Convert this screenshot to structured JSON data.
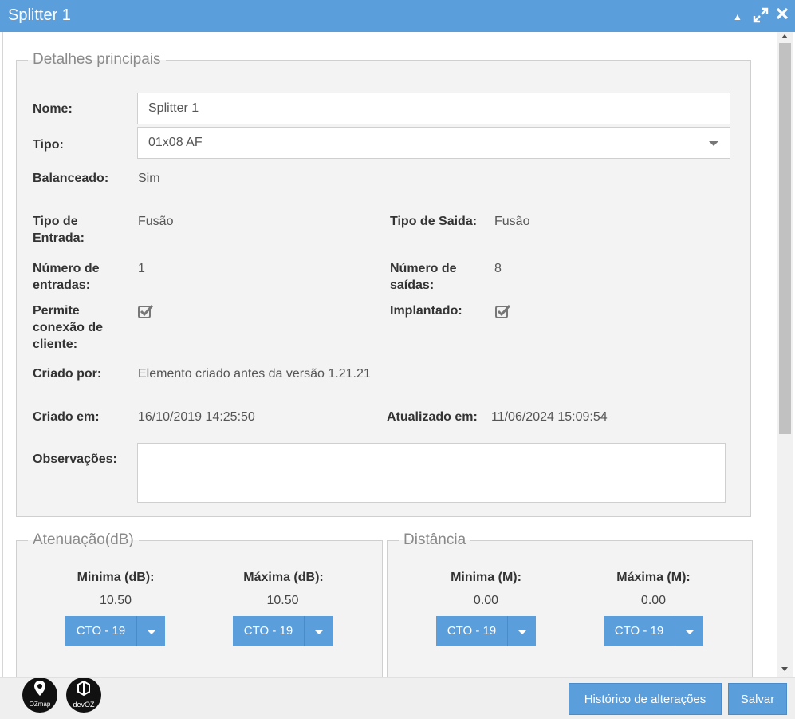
{
  "window": {
    "title": "Splitter 1",
    "controls": {
      "collapse": "▲",
      "expand": "⤢",
      "close": "✖"
    }
  },
  "main_section": {
    "legend": "Detalhes principais",
    "nome": {
      "label": "Nome:",
      "value": "Splitter 1"
    },
    "tipo": {
      "label": "Tipo:",
      "value": "01x08 AF"
    },
    "balanceado": {
      "label": "Balanceado:",
      "value": "Sim"
    },
    "tipo_entrada": {
      "label": "Tipo de Entrada:",
      "value": "Fusão"
    },
    "tipo_saida": {
      "label": "Tipo de Saida:",
      "value": "Fusão"
    },
    "numero_entradas": {
      "label": "Número de entradas:",
      "value": "1"
    },
    "numero_saidas": {
      "label": "Número de saídas:",
      "value": "8"
    },
    "permite_conexao": {
      "label": "Permite conexão de cliente:",
      "checked": true
    },
    "implantado": {
      "label": "Implantado:",
      "checked": true
    },
    "criado_por": {
      "label": "Criado por:",
      "value": "Elemento criado antes da versão 1.21.21"
    },
    "criado_em": {
      "label": "Criado em:",
      "value": "16/10/2019 14:25:50"
    },
    "atualizado_em": {
      "label": "Atualizado em:",
      "value": "11/06/2024 15:09:54"
    },
    "observacoes": {
      "label": "Observações:",
      "value": ""
    }
  },
  "atenuacao": {
    "legend": "Atenuação(dB)",
    "minima": {
      "label": "Minima (dB):",
      "value": "10.50",
      "button": "CTO - 19"
    },
    "maxima": {
      "label": "Máxima (dB):",
      "value": "10.50",
      "button": "CTO - 19"
    }
  },
  "distancia": {
    "legend": "Distância",
    "minima": {
      "label": "Minima (M):",
      "value": "0.00",
      "button": "CTO - 19"
    },
    "maxima": {
      "label": "Máxima (M):",
      "value": "0.00",
      "button": "CTO - 19"
    }
  },
  "footer": {
    "logo_ozmap": "OZmap",
    "logo_devoz": "devOZ",
    "historico_button": "Histórico de alterações",
    "salvar_button": "Salvar"
  },
  "colors": {
    "accent": "#5b9edc",
    "panel": "#f3f3f3"
  }
}
